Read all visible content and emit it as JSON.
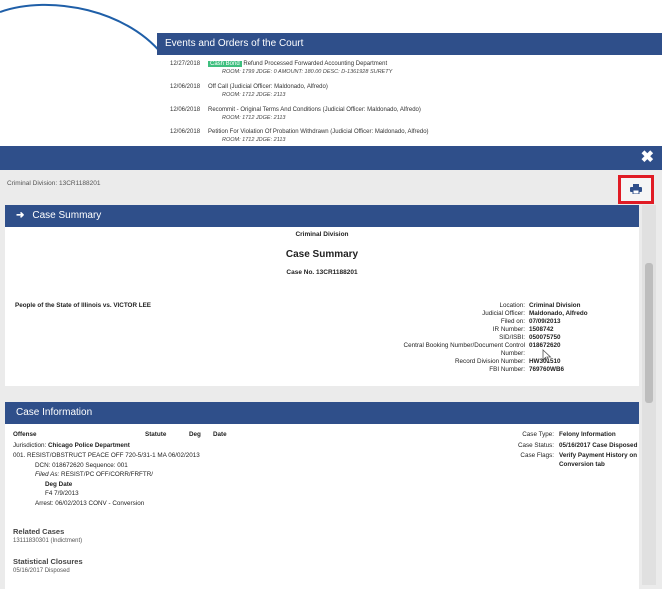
{
  "events": {
    "title": "Events and Orders of the Court",
    "rows": [
      {
        "date": "12/27/2018",
        "badge": "Cash Bond",
        "desc": "Refund Processed Forwarded Accounting Department",
        "sub": "ROOM: 1799 JDGE: 0 AMOUNT: 180.00 DESC: D-1361928 SURETY"
      },
      {
        "date": "12/06/2018",
        "badge": "",
        "desc": "Off Call   (Judicial Officer: Maldonado, Alfredo)",
        "sub": "ROOM: 1712 JDGE: 2113"
      },
      {
        "date": "12/06/2018",
        "badge": "",
        "desc": "Recommit - Original Terms And Conditions   (Judicial Officer: Maldonado, Alfredo)",
        "sub": "ROOM: 1712 JDGE: 2113"
      },
      {
        "date": "12/06/2018",
        "badge": "",
        "desc": "Petition For Violation Of Probation Withdrawn   (Judicial Officer: Maldonado, Alfredo)",
        "sub": "ROOM: 1712 JDGE: 2113"
      }
    ]
  },
  "modal": {
    "close_label": "✖",
    "breadcrumb": "Criminal Division: 13CR1188201",
    "summary": {
      "header": "Case Summary",
      "division": "Criminal Division",
      "title": "Case Summary",
      "case_no": "Case No. 13CR1188201",
      "party": "People of the State of Illinois vs. VICTOR LEE",
      "fields": [
        {
          "label": "Location:",
          "value": "Criminal Division"
        },
        {
          "label": "Judicial Officer:",
          "value": "Maldonado, Alfredo"
        },
        {
          "label": "Filed on:",
          "value": "07/09/2013"
        },
        {
          "label": "IR Number:",
          "value": "1508742"
        },
        {
          "label": "SID/ISBI:",
          "value": "050075750"
        },
        {
          "label": "Central Booking Number/Document Control",
          "value": "018672620"
        },
        {
          "label": "Number:",
          "value": ""
        },
        {
          "label": "Record Division Number:",
          "value": "HW301510"
        },
        {
          "label": "FBI Number:",
          "value": "769760WB6"
        }
      ]
    },
    "info": {
      "header": "Case Information",
      "col_offense": "Offense",
      "col_statute": "Statute",
      "col_deg": "Deg",
      "col_date": "Date",
      "jurisdiction_label": "Jurisdiction:",
      "jurisdiction": "Chicago Police Department",
      "offense_line": "001.  RESIST/OBSTRUCT PEACE OFF     720-5/31-1   MA   06/02/2013",
      "dcn_line": "DCN:  018672620     Sequence:  001",
      "filed_as_label": "Filed As:",
      "filed_as": "RESIST/PC OFF/CORR/FRFTR/",
      "deg_date_head": "Deg   Date",
      "deg_date_val": "F4     7/9/2013",
      "arrest_line": "Arrest:   06/02/2013    CONV - Conversion",
      "case_type_label": "Case Type:",
      "case_type": "Felony Information",
      "case_status_label": "Case Status:",
      "case_status": "05/16/2017  Case Disposed",
      "case_flags_label": "Case Flags:",
      "case_flags_1": "Verify Payment History on",
      "case_flags_2": "Conversion tab",
      "related_title": "Related Cases",
      "related_val": "13111830301 (Indictment)",
      "stat_title": "Statistical Closures",
      "stat_val": "05/16/2017  Disposed"
    }
  },
  "colors": {
    "header_blue": "#2f4f8a",
    "highlight_red": "#e01b24",
    "badge_green": "#3fbf7f",
    "annotation_blue": "#3a7bd5"
  },
  "icons": [
    "print-icon",
    "close-icon",
    "arrow-right-icon",
    "mouse-cursor-icon"
  ]
}
